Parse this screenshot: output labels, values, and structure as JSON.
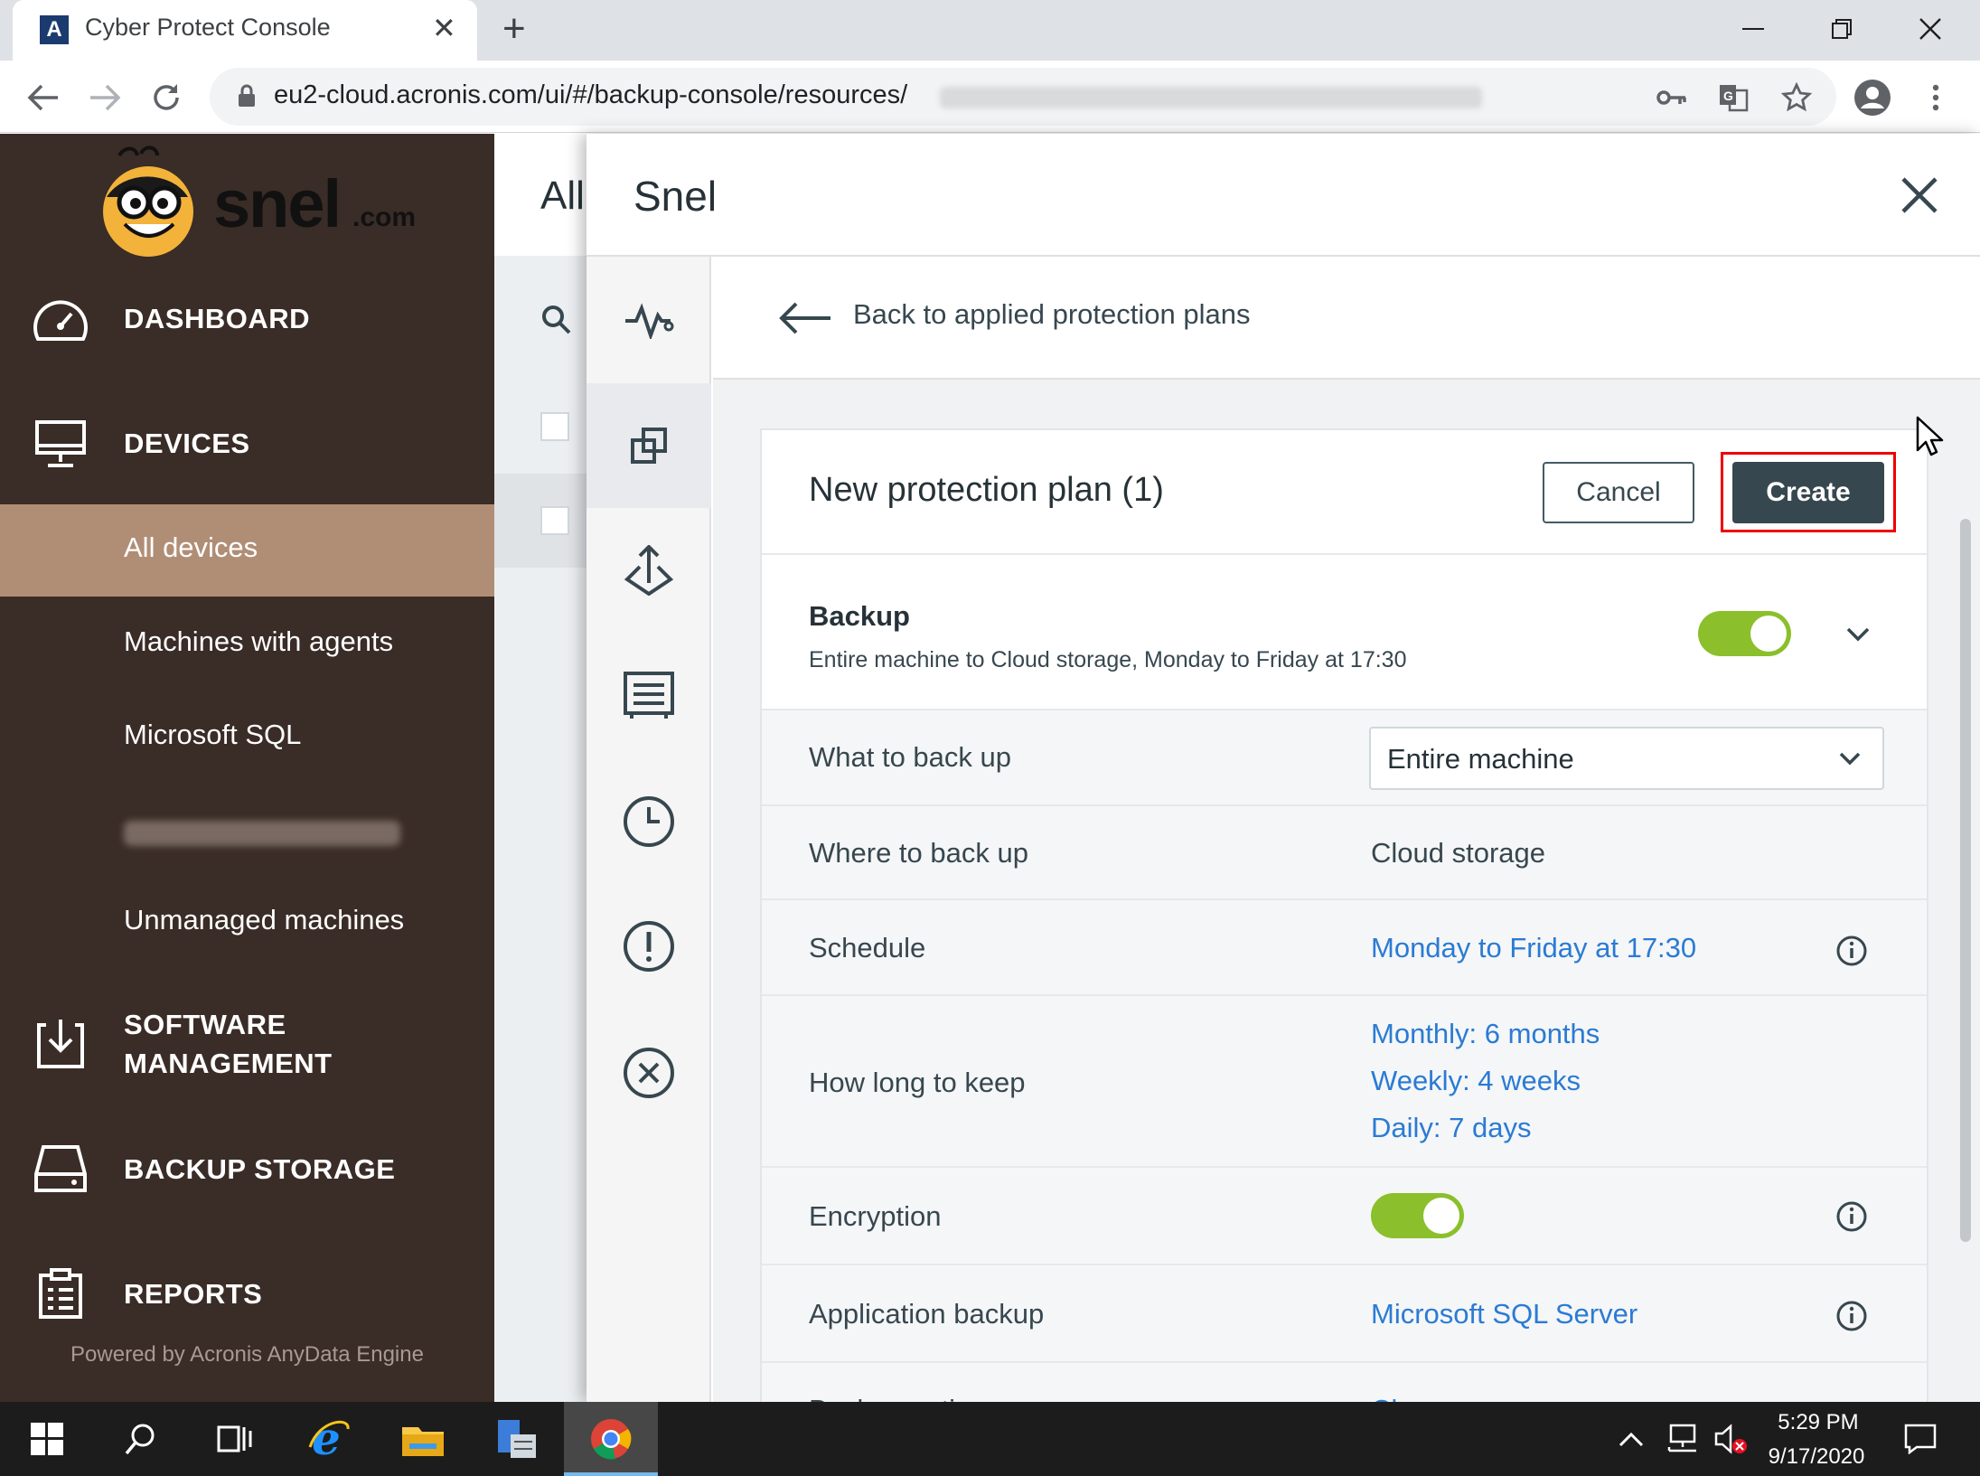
{
  "browser": {
    "tab_title": "Cyber Protect Console",
    "tab_favicon_letter": "A",
    "new_tab_symbol": "+",
    "url": "eu2-cloud.acronis.com/ui/#/backup-console/resources/"
  },
  "sidebar": {
    "logo_text": "snel",
    "logo_suffix": ".com",
    "items": [
      {
        "label": "DASHBOARD",
        "icon": "speedometer-icon"
      },
      {
        "label": "DEVICES",
        "icon": "monitor-icon"
      }
    ],
    "device_subitems": [
      {
        "label": "All devices",
        "selected": true
      },
      {
        "label": "Machines with agents",
        "selected": false
      },
      {
        "label": "Microsoft SQL",
        "selected": false
      },
      {
        "label": "Unmanaged machines",
        "selected": false
      }
    ],
    "software_management_line1": "SOFTWARE",
    "software_management_line2": "MANAGEMENT",
    "backup_storage": "BACKUP STORAGE",
    "reports": "REPORTS",
    "powered_by": "Powered by Acronis AnyData Engine"
  },
  "background_page": {
    "title": "All"
  },
  "panel": {
    "title": "Snel",
    "back_label": "Back to applied protection plans",
    "plan": {
      "title": "New protection plan (1)",
      "cancel_label": "Cancel",
      "create_label": "Create",
      "backup_title": "Backup",
      "backup_summary": "Entire machine to Cloud storage, Monday to Friday at 17:30",
      "backup_enabled": true,
      "rows": {
        "what_label": "What to back up",
        "what_value": "Entire machine",
        "where_label": "Where to back up",
        "where_value": "Cloud storage",
        "schedule_label": "Schedule",
        "schedule_value": "Monday to Friday at 17:30",
        "keep_label": "How long to keep",
        "keep_monthly": "Monthly: 6 months",
        "keep_weekly": "Weekly: 4 weeks",
        "keep_daily": "Daily: 7 days",
        "encryption_label": "Encryption",
        "encryption_enabled": true,
        "app_backup_label": "Application backup",
        "app_backup_value": "Microsoft SQL Server",
        "options_label": "Backup options",
        "options_value": "Change"
      }
    }
  },
  "taskbar": {
    "time": "5:29 PM",
    "date": "9/17/2020"
  },
  "colors": {
    "sidebar_bg": "#3a2c26",
    "sidebar_selected": "#b08e76",
    "accent_link": "#2a7bd4",
    "toggle_on": "#8bbf2b",
    "primary_button": "#37474f",
    "highlight_box": "#e00000"
  }
}
